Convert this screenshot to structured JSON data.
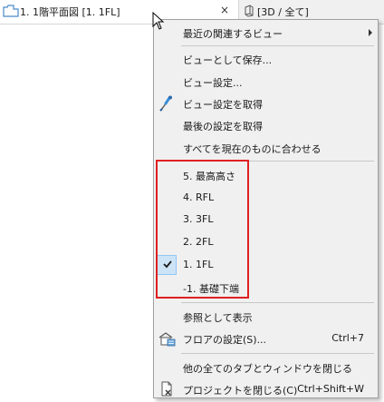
{
  "tabs": {
    "active": {
      "title": "1. 1階平面図 [1. 1FL]",
      "close": "×"
    },
    "inactive": {
      "title": "[3D / 全て]"
    }
  },
  "menu": {
    "items": [
      {
        "label": "最近の関連するビュー",
        "submenu": true
      },
      {
        "label": "ビューとして保存..."
      },
      {
        "label": "ビュー設定..."
      },
      {
        "label": "ビュー設定を取得",
        "icon": "eyedropper-icon"
      },
      {
        "label": "最後の設定を取得"
      },
      {
        "label": "すべてを現在のものに合わせる"
      },
      {
        "label": "5. 最高高さ"
      },
      {
        "label": "4. RFL"
      },
      {
        "label": "3. 3FL"
      },
      {
        "label": "2. 2FL"
      },
      {
        "label": "1. 1FL",
        "checked": true
      },
      {
        "label": "-1. 基礎下端"
      },
      {
        "label": "参照として表示"
      },
      {
        "label": "フロアの設定(S)...",
        "shortcut": "Ctrl+7",
        "icon": "floor-settings-icon"
      },
      {
        "label": "他の全てのタブとウィンドウを閉じる"
      },
      {
        "label": "プロジェクトを閉じる(C)",
        "shortcut": "Ctrl+Shift+W",
        "icon": "close-project-icon"
      }
    ]
  },
  "colors": {
    "highlight_box": "#e02020",
    "check_bg": "#cde4f7",
    "menu_bg": "#f0f0f0"
  }
}
